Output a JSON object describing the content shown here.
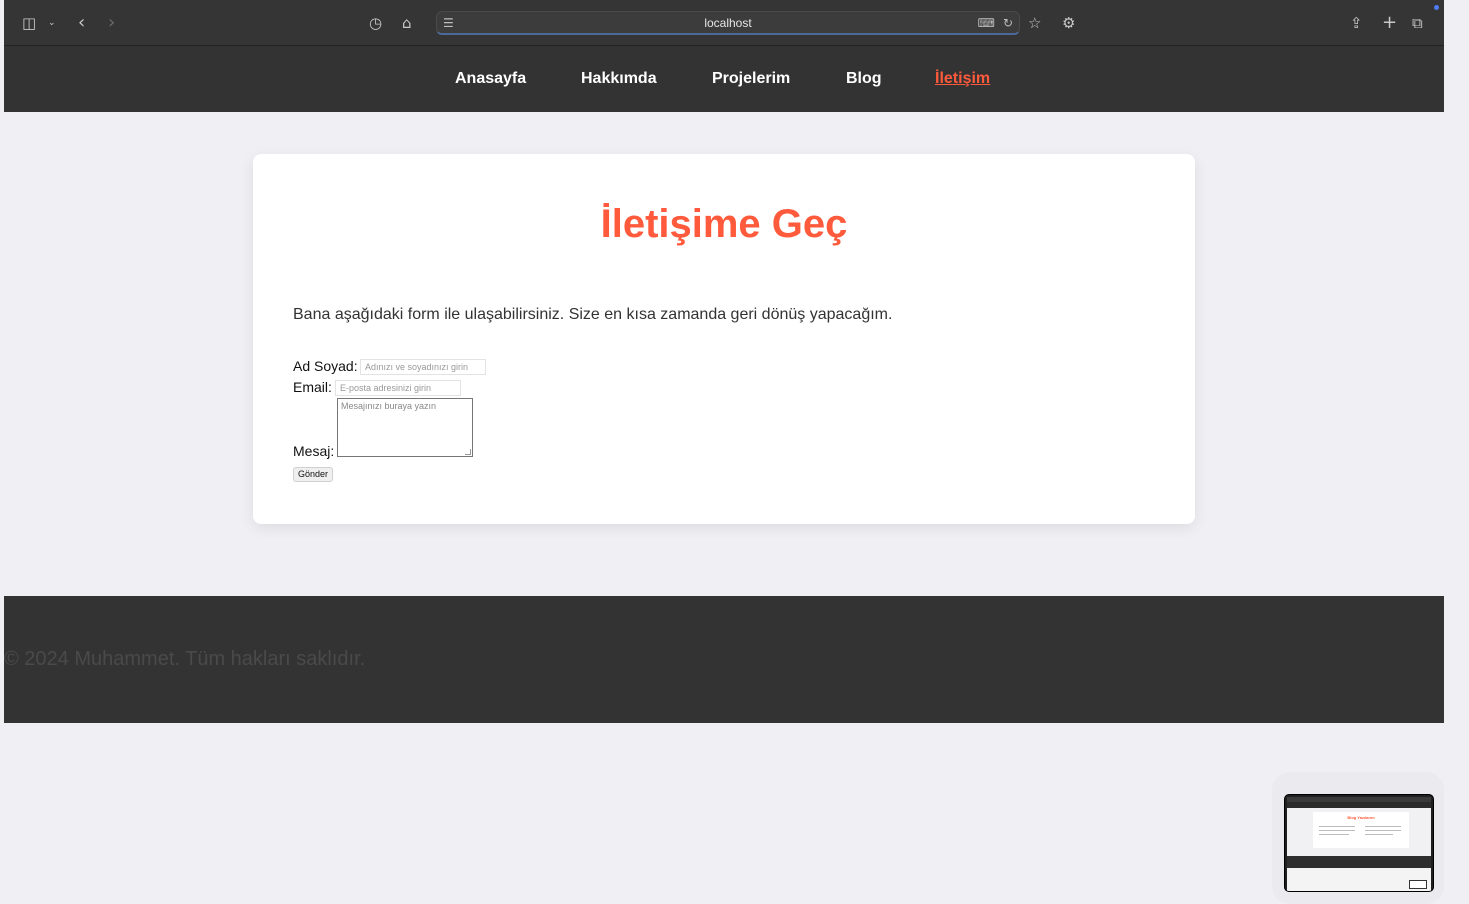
{
  "browser": {
    "url": "localhost",
    "icons": {
      "sidebar": "sidebar-icon",
      "chevron": "chevron-down-icon",
      "back": "back-icon",
      "forward": "forward-icon",
      "history": "clock-icon",
      "home": "home-icon",
      "page_menu": "page-menu-icon",
      "translate": "translate-icon",
      "reload": "reload-icon",
      "bookmark": "star-icon",
      "extensions": "gear-icon",
      "share": "share-icon",
      "new_tab": "plus-icon",
      "tabs": "tabs-overview-icon"
    }
  },
  "nav": {
    "items": [
      {
        "label": "Anasayfa",
        "active": false
      },
      {
        "label": "Hakkımda",
        "active": false
      },
      {
        "label": "Projelerim",
        "active": false
      },
      {
        "label": "Blog",
        "active": false
      },
      {
        "label": "İletişim",
        "active": true
      }
    ]
  },
  "contact": {
    "title": "İletişime Geç",
    "description": "Bana aşağıdaki form ile ulaşabilirsiniz. Size en kısa zamanda geri dönüş yapacağım.",
    "form": {
      "name_label": "Ad Soyad:",
      "name_placeholder": "Adınızı ve soyadınızı girin",
      "email_label": "Email:",
      "email_placeholder": "E-posta adresinizi girin",
      "message_label": "Mesaj:",
      "message_placeholder": "Mesajınızı buraya yazın",
      "submit_label": "Gönder"
    }
  },
  "footer": {
    "text": "© 2024 Muhammet. Tüm hakları saklıdır."
  },
  "preview": {
    "title": "Blog Yazılarım"
  },
  "colors": {
    "accent": "#ff5a3c",
    "nav_bg": "#333333",
    "page_bg": "#f0eff4"
  }
}
